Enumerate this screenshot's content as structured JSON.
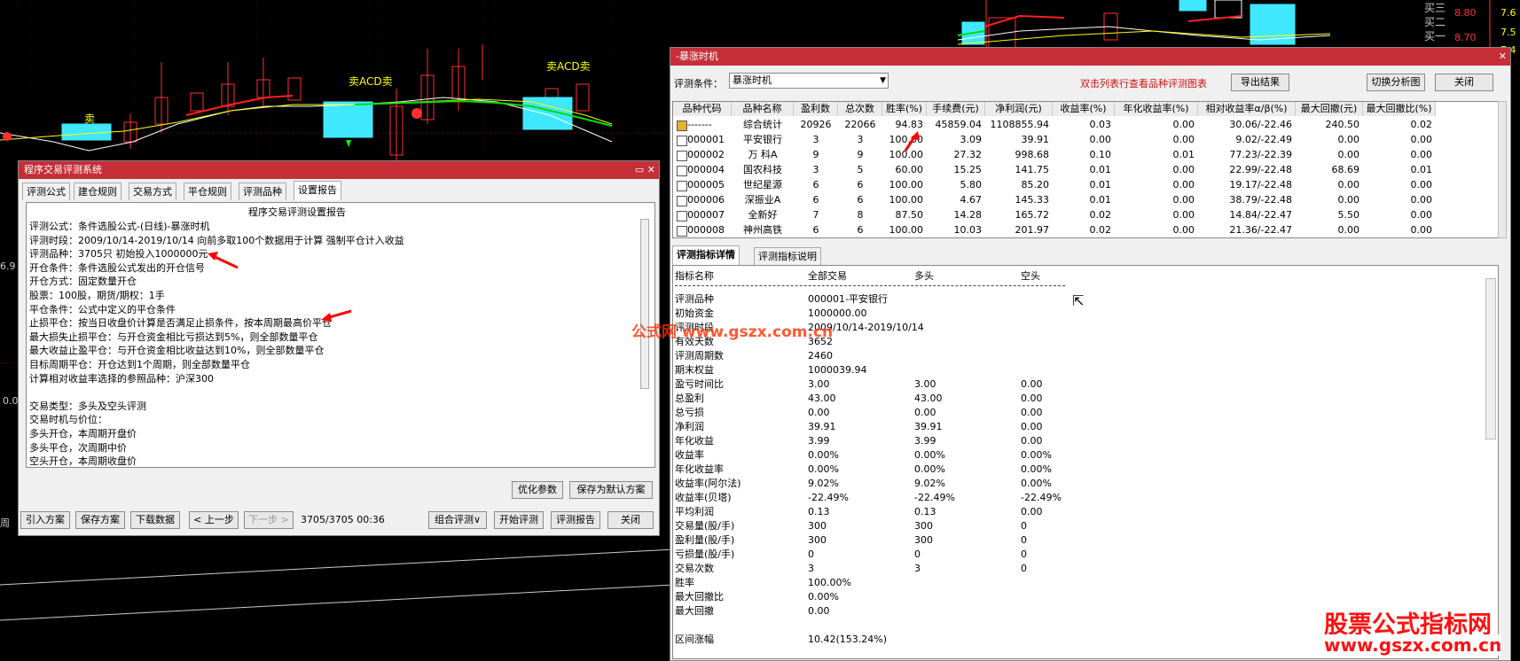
{
  "candle_labels": {
    "sell1": "卖",
    "acd1": "卖ACD卖",
    "acd2": "卖ACD卖"
  },
  "right_axis": {
    "p1": "8.80",
    "p2": "8.70",
    "t1": "买三",
    "t2": "买二",
    "t3": "买一",
    "r1": "7.6",
    "r2": "7.5",
    "r3": "7.4"
  },
  "left_axis": {
    "a": "6.9",
    "b": "0.0",
    "c": "周"
  },
  "w1": {
    "title": "程序交易评测系统",
    "tabs": [
      "评测公式",
      "建仓规则",
      "交易方式",
      "平仓规则",
      "评测品种",
      "设置报告"
    ],
    "report": {
      "heading": "程序交易评测设置报告",
      "lines": [
        "评测公式：条件选股公式-(日线)-暴涨时机",
        "评测时段：2009/10/14-2019/10/14 向前多取100个数据用于计算 强制平仓计入收益",
        "评测品种：3705只 初始投入1000000元",
        "开仓条件：条件选股公式发出的开仓信号",
        "开仓方式：固定数量开仓",
        "            股票：100股，期货/期权：1手",
        "平仓条件：公式中定义的平仓条件",
        "止损平仓：按当日收盘价计算是否满足止损条件，按本周期最高价平仓",
        "            最大损失止损平仓：与开仓资金相比亏损达到5%，则全部数量平仓",
        "            最大收益止盈平仓：与开仓资金相比收益达到10%，则全部数量平仓",
        "            目标周期平仓：开仓达到1个周期，则全部数量平仓",
        "            计算相对收益率选择的参照品种：沪深300",
        "",
        "交易类型：多头及空头评测",
        "交易时机与价位：",
        "            多头开仓，本周期开盘价",
        "            多头平仓，次周期中价",
        "            空头开仓，本周期收盘价"
      ]
    },
    "btn_optimize": "优化参数",
    "btn_save_default": "保存为默认方案",
    "bottom_buttons": [
      "引入方案",
      "保存方案",
      "下载数据",
      "< 上一步",
      "下一步 >"
    ],
    "progress": "3705/3705 00:36",
    "bottom_right_buttons": [
      "组合评测∨",
      "开始评测",
      "评测报告",
      "关闭"
    ]
  },
  "w2": {
    "title": "-暴涨时机",
    "cond_label": "评测条件：",
    "cond_value": "暴涨时机",
    "hint": "双击列表行查看品种评测图表",
    "btn_export": "导出结果",
    "btn_switch": "切换分析图",
    "btn_close": "关闭",
    "columns": [
      "品种代码",
      "品种名称",
      "盈利数",
      "总次数",
      "胜率(%)",
      "手续费(元)",
      "净利润(元)",
      "收益率(%)",
      "年化收益率(%)",
      "相对收益率α/β(%)",
      "最大回撤(元)",
      "最大回撤比(%)"
    ],
    "rows": [
      [
        "-------",
        "综合统计",
        "20926",
        "22066",
        "94.83",
        "45859.04",
        "1108855.94",
        "0.03",
        "0.00",
        "30.06/-22.46",
        "240.50",
        "0.02"
      ],
      [
        "000001",
        "平安银行",
        "3",
        "3",
        "100.00",
        "3.09",
        "39.91",
        "0.00",
        "0.00",
        "9.02/-22.49",
        "0.00",
        "0.00"
      ],
      [
        "000002",
        "万 科A",
        "9",
        "9",
        "100.00",
        "27.32",
        "998.68",
        "0.10",
        "0.01",
        "77.23/-22.39",
        "0.00",
        "0.00"
      ],
      [
        "000004",
        "国农科技",
        "3",
        "5",
        "60.00",
        "15.25",
        "141.75",
        "0.01",
        "0.00",
        "22.99/-22.48",
        "68.69",
        "0.01"
      ],
      [
        "000005",
        "世纪星源",
        "6",
        "6",
        "100.00",
        "5.80",
        "85.20",
        "0.01",
        "0.00",
        "19.17/-22.48",
        "0.00",
        "0.00"
      ],
      [
        "000006",
        "深振业A",
        "6",
        "6",
        "100.00",
        "4.67",
        "145.33",
        "0.01",
        "0.00",
        "38.79/-22.48",
        "0.00",
        "0.00"
      ],
      [
        "000007",
        "全新好",
        "7",
        "8",
        "87.50",
        "14.28",
        "165.72",
        "0.02",
        "0.00",
        "14.84/-22.47",
        "5.50",
        "0.00"
      ],
      [
        "000008",
        "神州高铁",
        "6",
        "6",
        "100.00",
        "10.03",
        "201.97",
        "0.02",
        "0.00",
        "21.36/-22.47",
        "0.00",
        "0.00"
      ]
    ],
    "detail_tabs": [
      "评测指标详情",
      "评测指标说明"
    ],
    "detail_headers": [
      "指标名称",
      "全部交易",
      "多头",
      "空头"
    ],
    "detail_rows": [
      [
        "评测品种",
        "000001-平安银行",
        "",
        ""
      ],
      [
        "初始资金",
        "1000000.00",
        "",
        ""
      ],
      [
        "评测时段",
        "2009/10/14-2019/10/14",
        "",
        ""
      ],
      [
        "有效天数",
        "3652",
        "",
        ""
      ],
      [
        "评测周期数",
        "2460",
        "",
        ""
      ],
      [
        "期末权益",
        "1000039.94",
        "",
        ""
      ],
      [
        "盈亏时间比",
        "3.00",
        "3.00",
        "0.00"
      ],
      [
        "总盈利",
        "43.00",
        "43.00",
        "0.00"
      ],
      [
        "总亏损",
        "0.00",
        "0.00",
        "0.00"
      ],
      [
        "净利润",
        "39.91",
        "39.91",
        "0.00"
      ],
      [
        "年化收益",
        "3.99",
        "3.99",
        "0.00"
      ],
      [
        "收益率",
        "0.00%",
        "0.00%",
        "0.00%"
      ],
      [
        "年化收益率",
        "0.00%",
        "0.00%",
        "0.00%"
      ],
      [
        "收益率(阿尔法)",
        "9.02%",
        "9.02%",
        "0.00%"
      ],
      [
        "收益率(贝塔)",
        "-22.49%",
        "-22.49%",
        "-22.49%"
      ],
      [
        "平均利润",
        "0.13",
        "0.13",
        "0.00"
      ],
      [
        "交易量(股/手)",
        "300",
        "300",
        "0"
      ],
      [
        "盈利量(股/手)",
        "300",
        "300",
        "0"
      ],
      [
        "亏损量(股/手)",
        "0",
        "0",
        "0"
      ],
      [
        "交易次数",
        "3",
        "3",
        "0"
      ],
      [
        "胜率",
        "100.00%",
        "",
        ""
      ],
      [
        "最大回撤比",
        "0.00%",
        "",
        ""
      ],
      [
        "最大回撤",
        "0.00",
        "",
        ""
      ],
      [
        "",
        "",
        " ",
        ""
      ],
      [
        "区间涨幅",
        "10.42(153.24%)",
        "",
        ""
      ]
    ]
  },
  "watermark": {
    "center": "公式网 www.gszx.com.cn",
    "big": "股票公式指标网",
    "url": "www.gszx.com.cn"
  }
}
